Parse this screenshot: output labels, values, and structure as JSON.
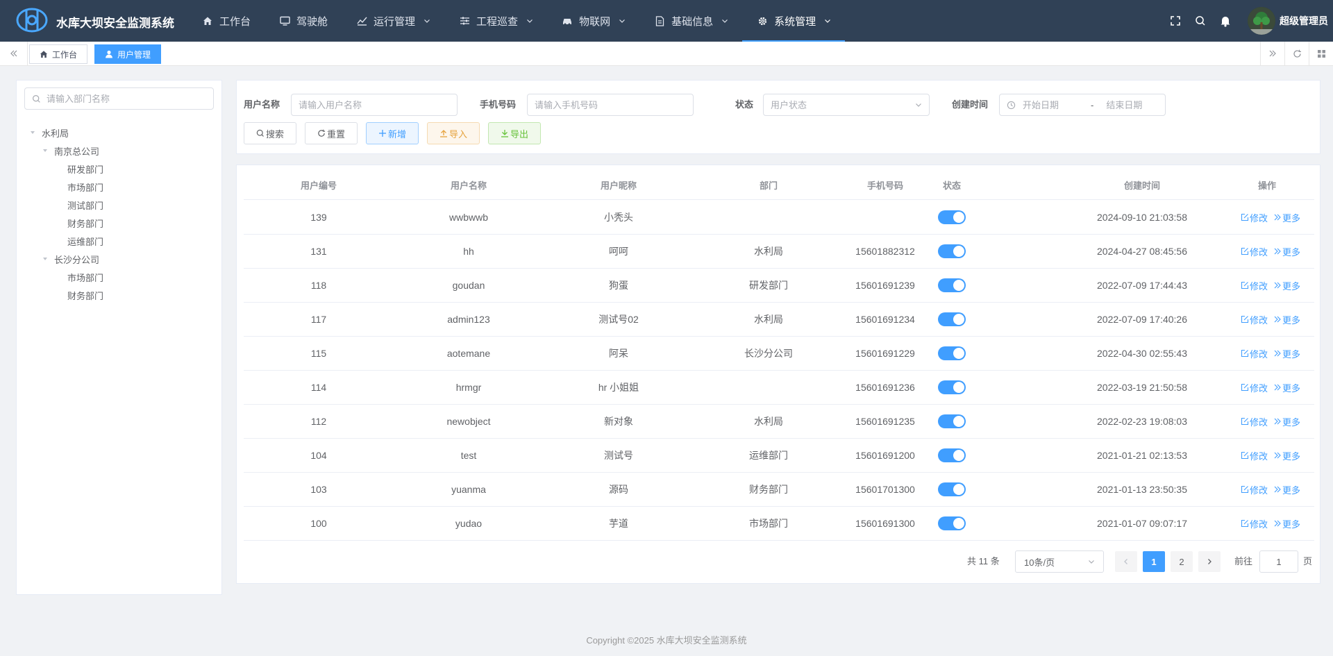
{
  "header": {
    "app_title": "水库大坝安全监测系统",
    "nav": [
      {
        "label": "工作台",
        "icon": "home-icon",
        "dropdown": false,
        "active": false
      },
      {
        "label": "驾驶舱",
        "icon": "monitor-icon",
        "dropdown": false,
        "active": false
      },
      {
        "label": "运行管理",
        "icon": "chart-line-icon",
        "dropdown": true,
        "active": false
      },
      {
        "label": "工程巡查",
        "icon": "sliders-icon",
        "dropdown": true,
        "active": false
      },
      {
        "label": "物联网",
        "icon": "car-icon",
        "dropdown": true,
        "active": false
      },
      {
        "label": "基础信息",
        "icon": "document-icon",
        "dropdown": true,
        "active": false
      },
      {
        "label": "系统管理",
        "icon": "gear-icon",
        "dropdown": true,
        "active": true
      }
    ],
    "username": "超级管理员"
  },
  "tags": {
    "items": [
      {
        "label": "工作台",
        "icon": "home-icon",
        "active": false
      },
      {
        "label": "用户管理",
        "icon": "user-icon",
        "active": true
      }
    ]
  },
  "dept": {
    "search_placeholder": "请输入部门名称",
    "tree": [
      {
        "label": "水利局",
        "level": 0,
        "expandable": true
      },
      {
        "label": "南京总公司",
        "level": 1,
        "expandable": true
      },
      {
        "label": "研发部门",
        "level": 2,
        "expandable": false
      },
      {
        "label": "市场部门",
        "level": 2,
        "expandable": false
      },
      {
        "label": "测试部门",
        "level": 2,
        "expandable": false
      },
      {
        "label": "财务部门",
        "level": 2,
        "expandable": false
      },
      {
        "label": "运维部门",
        "level": 2,
        "expandable": false
      },
      {
        "label": "长沙分公司",
        "level": 1,
        "expandable": true
      },
      {
        "label": "市场部门",
        "level": 2,
        "expandable": false
      },
      {
        "label": "财务部门",
        "level": 2,
        "expandable": false
      }
    ]
  },
  "form": {
    "username_label": "用户名称",
    "username_placeholder": "请输入用户名称",
    "phone_label": "手机号码",
    "phone_placeholder": "请输入手机号码",
    "status_label": "状态",
    "status_placeholder": "用户状态",
    "created_label": "创建时间",
    "start_placeholder": "开始日期",
    "range_sep": "-",
    "end_placeholder": "结束日期",
    "buttons": {
      "search": "搜索",
      "reset": "重置",
      "add": "新增",
      "import": "导入",
      "export": "导出"
    }
  },
  "table": {
    "columns": [
      "用户编号",
      "用户名称",
      "用户昵称",
      "部门",
      "手机号码",
      "状态",
      "创建时间",
      "操作"
    ],
    "edit_label": "修改",
    "more_label": "更多",
    "rows": [
      {
        "id": "139",
        "name": "wwbwwb",
        "nick": "小秃头",
        "dept": "",
        "phone": "",
        "enabled": true,
        "created": "2024-09-10 21:03:58"
      },
      {
        "id": "131",
        "name": "hh",
        "nick": "呵呵",
        "dept": "水利局",
        "phone": "15601882312",
        "enabled": true,
        "created": "2024-04-27 08:45:56"
      },
      {
        "id": "118",
        "name": "goudan",
        "nick": "狗蛋",
        "dept": "研发部门",
        "phone": "15601691239",
        "enabled": true,
        "created": "2022-07-09 17:44:43"
      },
      {
        "id": "117",
        "name": "admin123",
        "nick": "测试号02",
        "dept": "水利局",
        "phone": "15601691234",
        "enabled": true,
        "created": "2022-07-09 17:40:26"
      },
      {
        "id": "115",
        "name": "aotemane",
        "nick": "阿呆",
        "dept": "长沙分公司",
        "phone": "15601691229",
        "enabled": true,
        "created": "2022-04-30 02:55:43"
      },
      {
        "id": "114",
        "name": "hrmgr",
        "nick": "hr 小姐姐",
        "dept": "",
        "phone": "15601691236",
        "enabled": true,
        "created": "2022-03-19 21:50:58"
      },
      {
        "id": "112",
        "name": "newobject",
        "nick": "新对象",
        "dept": "水利局",
        "phone": "15601691235",
        "enabled": true,
        "created": "2022-02-23 19:08:03"
      },
      {
        "id": "104",
        "name": "test",
        "nick": "测试号",
        "dept": "运维部门",
        "phone": "15601691200",
        "enabled": true,
        "created": "2021-01-21 02:13:53"
      },
      {
        "id": "103",
        "name": "yuanma",
        "nick": "源码",
        "dept": "财务部门",
        "phone": "15601701300",
        "enabled": true,
        "created": "2021-01-13 23:50:35"
      },
      {
        "id": "100",
        "name": "yudao",
        "nick": "芋道",
        "dept": "市场部门",
        "phone": "15601691300",
        "enabled": true,
        "created": "2021-01-07 09:07:17"
      }
    ]
  },
  "pagination": {
    "total_text": "共 11 条",
    "page_size": "10条/页",
    "pages": [
      "1",
      "2"
    ],
    "current_page": "1",
    "goto_prefix": "前往",
    "goto_value": "1",
    "goto_suffix": "页"
  },
  "footer": {
    "copyright": "Copyright ©2025 水库大坝安全监测系统"
  },
  "colors": {
    "header_bg": "#304156",
    "primary": "#409eff",
    "warning": "#e6a23c",
    "success": "#67c23a"
  }
}
